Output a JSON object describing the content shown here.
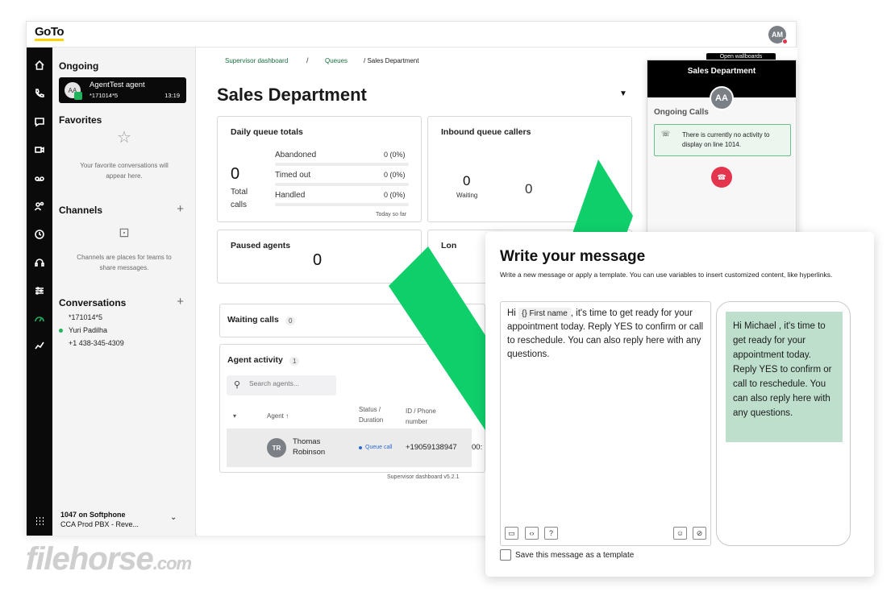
{
  "app": {
    "logo": "GoTo",
    "user_initials": "AM"
  },
  "nav_icons": [
    "home-icon",
    "phone-icon",
    "chat-icon",
    "video-icon",
    "voicemail-icon",
    "contacts-icon",
    "history-icon",
    "headset-icon",
    "settings-icon",
    "analytics-icon",
    "trend-icon",
    "apps-grid-icon"
  ],
  "sidebar": {
    "ongoing_title": "Ongoing",
    "ongoing_call": {
      "avatar": "AA",
      "name": "AgentTest agent",
      "ext": "*171014*5",
      "time": "13:19"
    },
    "favorites_title": "Favorites",
    "favorites_empty": "Your favorite conversations will appear here.",
    "channels_title": "Channels",
    "channels_empty": "Channels are places for teams to share messages.",
    "conversations_title": "Conversations",
    "conversations": [
      "*171014*5",
      "Yuri Padilha",
      "+1 438-345-4309"
    ],
    "plus": "+",
    "softphone_title": "1047 on Softphone",
    "softphone_sub": "CCA Prod PBX - Reve..."
  },
  "breadcrumb": {
    "item1": "Supervisor dashboard",
    "item2": "Queues",
    "sep": "/",
    "current": "/ Sales Department"
  },
  "page_title": "Sales Department",
  "daily_totals": {
    "title": "Daily queue totals",
    "total": "0",
    "total_label": "Total calls",
    "rows": [
      {
        "label": "Abandoned",
        "value": "0 (0%)"
      },
      {
        "label": "Timed out",
        "value": "0 (0%)"
      },
      {
        "label": "Handled",
        "value": "0 (0%)"
      }
    ],
    "footnote": "Today so far"
  },
  "inbound": {
    "title": "Inbound queue callers",
    "waiting": "0",
    "waiting_label": "Waiting",
    "second": "0"
  },
  "paused": {
    "title": "Paused agents",
    "value": "0"
  },
  "longest_partial": "Lon",
  "waiting_calls": {
    "title": "Waiting calls",
    "count": "0"
  },
  "agent_activity": {
    "title": "Agent activity",
    "count": "1",
    "search_placeholder": "Search agents...",
    "columns": {
      "agent": "Agent",
      "status": "Status / Duration",
      "id_phone": "ID / Phone number"
    },
    "row": {
      "initials": "TR",
      "name": "Thomas Robinson",
      "status": "Queue call",
      "phone": "+19059138947",
      "duration": "00:"
    }
  },
  "version": "Supervisor dashboard v5.2.1",
  "call_panel": {
    "wallboard_btn": "Open wallboards",
    "title": "Sales Department",
    "avatar": "AA",
    "section": "Ongoing Calls",
    "notice": "There is currently no activity to display on line 1014."
  },
  "message": {
    "title": "Write your message",
    "description": "Write a new message or apply a template. You can use variables to insert customized content, like hyperlinks.",
    "compose_pre": "Hi",
    "chip": "{} First name",
    "compose_post": ", it's time to get ready for your appointment today. Reply YES to confirm or call to reschedule. You can also reply here with any questions.",
    "preview": "Hi Michael , it's time to get ready for your appointment today. Reply YES to confirm or call to reschedule. You can also reply here with any questions.",
    "save_template": "Save this message as a template"
  },
  "watermark": {
    "main": "filehorse",
    "suffix": ".com"
  },
  "colors": {
    "accent_green": "#0fcf6b",
    "bubble": "#bddfcc",
    "hangup": "#e5344d",
    "nav_bg": "#0a0a0a"
  }
}
